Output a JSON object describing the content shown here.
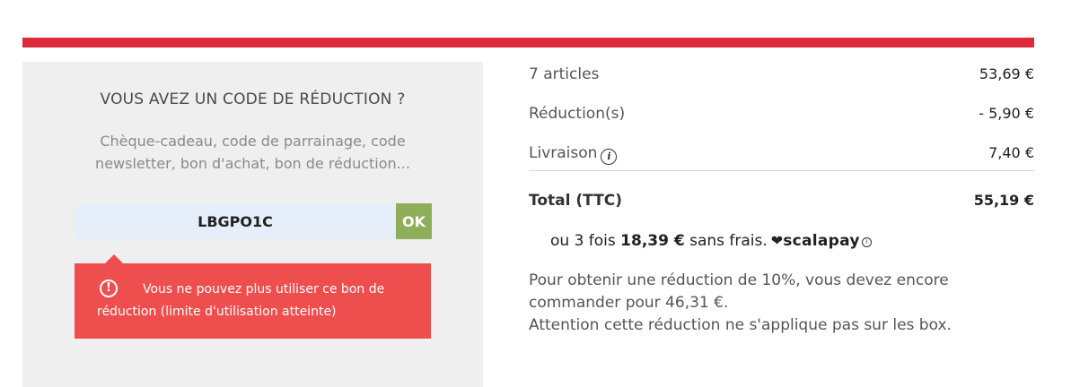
{
  "colors": {
    "accent_bar": "#dc2a3c",
    "panel_bg": "#efefef",
    "input_bg": "#e6eefa",
    "ok_button": "#8fae5a",
    "error_bg": "#ef4e4e"
  },
  "promo": {
    "title": "VOUS AVEZ UN CODE DE RÉDUCTION ?",
    "description": "Chèque-cadeau, code de parrainage, code newsletter, bon d'achat, bon de réduction...",
    "code_value": "LBGPO1C",
    "ok_label": "OK",
    "error_icon": "!",
    "error_message": "Vous ne pouvez plus utiliser ce bon de réduction (limite d'utilisation atteinte)"
  },
  "summary": {
    "articles_label": "7 articles",
    "articles_value": "53,69 €",
    "reduction_label": "Réduction(s)",
    "reduction_value": "- 5,90 €",
    "delivery_label": "Livraison",
    "delivery_info_icon": "i",
    "delivery_value": "7,40 €",
    "total_label": "Total (TTC)",
    "total_value": "55,19 €"
  },
  "scalapay": {
    "prefix": "ou 3 fois",
    "amount": "18,39 €",
    "suffix": "sans frais.",
    "heart": "❤",
    "brand": "scalapay",
    "info": "i"
  },
  "notice": {
    "line1": "Pour obtenir une réduction de 10%, vous devez encore commander pour 46,31 €.",
    "line2": "Attention cette réduction ne s'applique pas sur les box."
  }
}
